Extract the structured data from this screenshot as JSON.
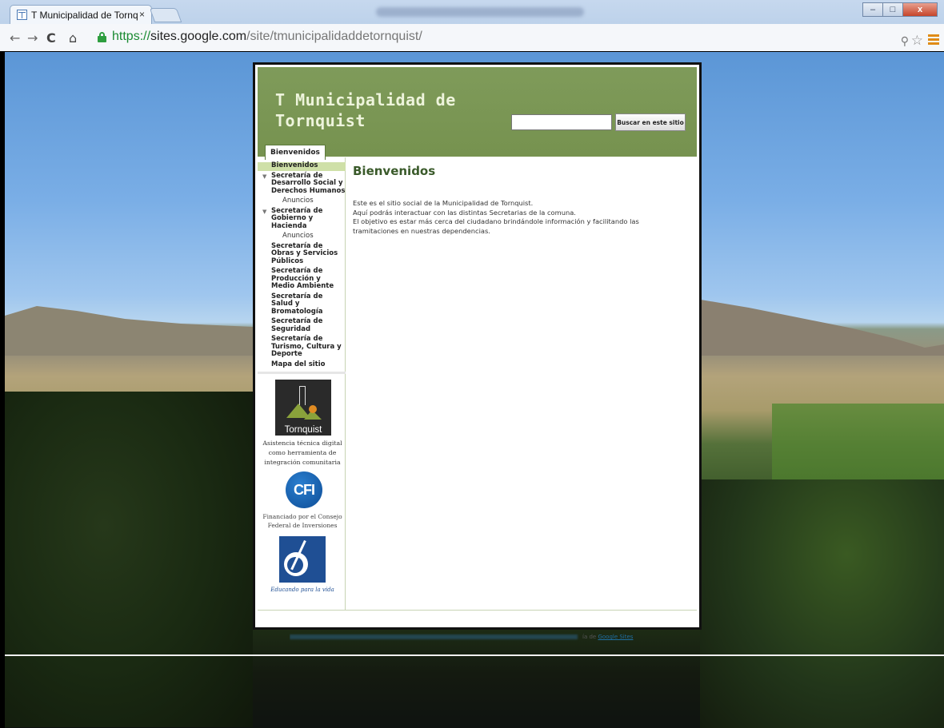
{
  "browser": {
    "tab_title": "T Municipalidad de Tornq",
    "tab_close": "×",
    "url_scheme": "https://",
    "url_host": "sites.google.com",
    "url_path": "/site/tmunicipalidaddetornquist/",
    "window_buttons": [
      "–",
      "□",
      "x"
    ]
  },
  "site": {
    "title_line1": "T Municipalidad de",
    "title_line2": "Tornquist",
    "search_button": "Buscar en este sitio",
    "search_value": "",
    "nav_tab": "Bienvenidos"
  },
  "sidebar": {
    "items": [
      {
        "label": "Bienvenidos",
        "current": true
      },
      {
        "label": "Secretaría de Desarrollo Social y Derechos Humanos",
        "expanded": true
      },
      {
        "label": "Anuncios",
        "sub": true
      },
      {
        "label": "Secretaría de Gobierno y Hacienda",
        "expanded": true
      },
      {
        "label": "Anuncios",
        "sub": true
      },
      {
        "label": "Secretaría de Obras y Servicios Públicos"
      },
      {
        "label": "Secretaría de Producción y Medio Ambiente"
      },
      {
        "label": "Secretaría de Salud y Bromatología"
      },
      {
        "label": "Secretaría de Seguridad"
      },
      {
        "label": "Secretaría de Turismo, Cultura y Deporte"
      },
      {
        "label": "Mapa del sitio"
      }
    ],
    "logo_name": "Tornquist",
    "caption1": "Asistencia técnica digital como herramienta de integración comunitaria",
    "cfi_logo": "CFI",
    "caption2": "Financiado por el Consejo Federal de Inversiones",
    "edu_caption": "Educando para la vida"
  },
  "main": {
    "heading": "Bienvenidos",
    "paragraph_lines": [
      "Este es el sitio social de la Municipalidad de Tornquist.",
      "Aquí podrás interactuar con las distintas Secretarias de la comuna.",
      "El objetivo es estar más cerca del ciudadano brindándole información y facilitando las",
      "tramitaciones en nuestras dependencias."
    ]
  },
  "footer": {
    "powered_by": "ía de",
    "google_link": "Google Sites"
  },
  "colors": {
    "header_green": "#7f9b5a",
    "link_green": "#3a5a2a",
    "nav_highlight": "#cfe0a8"
  }
}
